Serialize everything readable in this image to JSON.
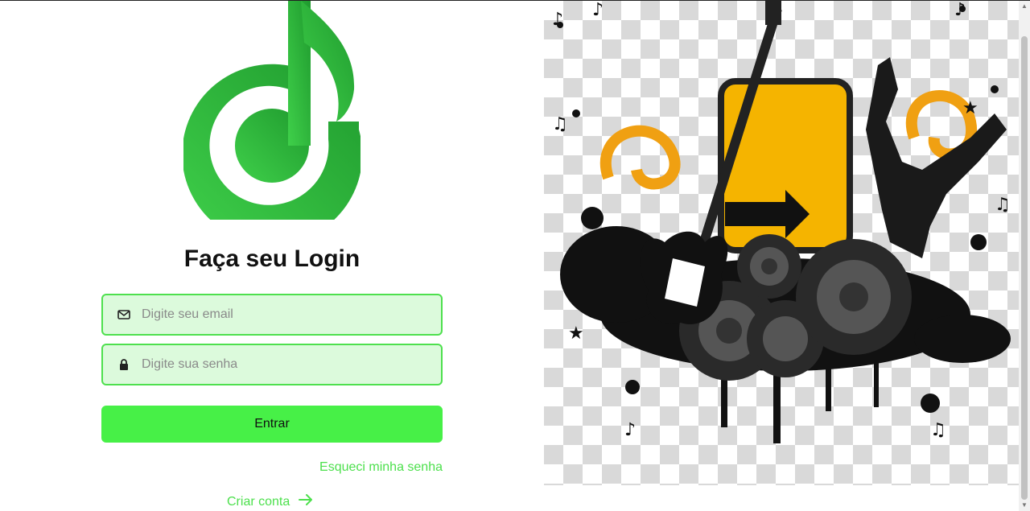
{
  "logo": {
    "name": "music-note-logo",
    "color": "#2fc23f"
  },
  "login": {
    "title": "Faça seu Login",
    "email_placeholder": "Digite seu email",
    "password_placeholder": "Digite sua senha",
    "submit_label": "Entrar",
    "forgot_label": "Esqueci minha senha",
    "create_label": "Criar conta"
  },
  "icons": {
    "email": "mail-icon",
    "password": "lock-icon",
    "create": "arrow-right-icon"
  },
  "colors": {
    "accent": "#47f047",
    "field_bg": "#dcfadc",
    "field_border": "#4ee04e",
    "link": "#4de04d"
  }
}
